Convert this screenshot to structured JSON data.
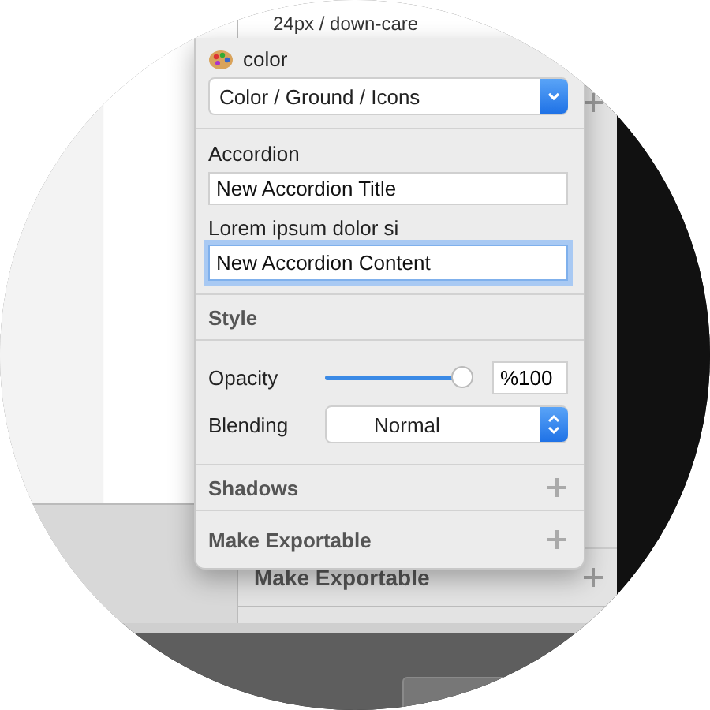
{
  "background": {
    "header_fragment": "24px / down-care",
    "section": "Make Exportable"
  },
  "popover": {
    "symbol": {
      "label": "color",
      "value": "Color / Ground / Icons"
    },
    "overrides_title": "Accordion",
    "overrides": [
      {
        "value": "New Accordion Title",
        "focused": false
      },
      {
        "label": "Lorem ipsum dolor si",
        "value": "New Accordion Content",
        "focused": true
      }
    ],
    "style": {
      "title": "Style",
      "opacity": {
        "label": "Opacity",
        "level": 1,
        "value": "%100"
      },
      "blending": {
        "label": "Blending",
        "value": "Normal"
      }
    },
    "sections": [
      {
        "title": "Shadows"
      },
      {
        "title": "Make Exportable"
      }
    ]
  }
}
